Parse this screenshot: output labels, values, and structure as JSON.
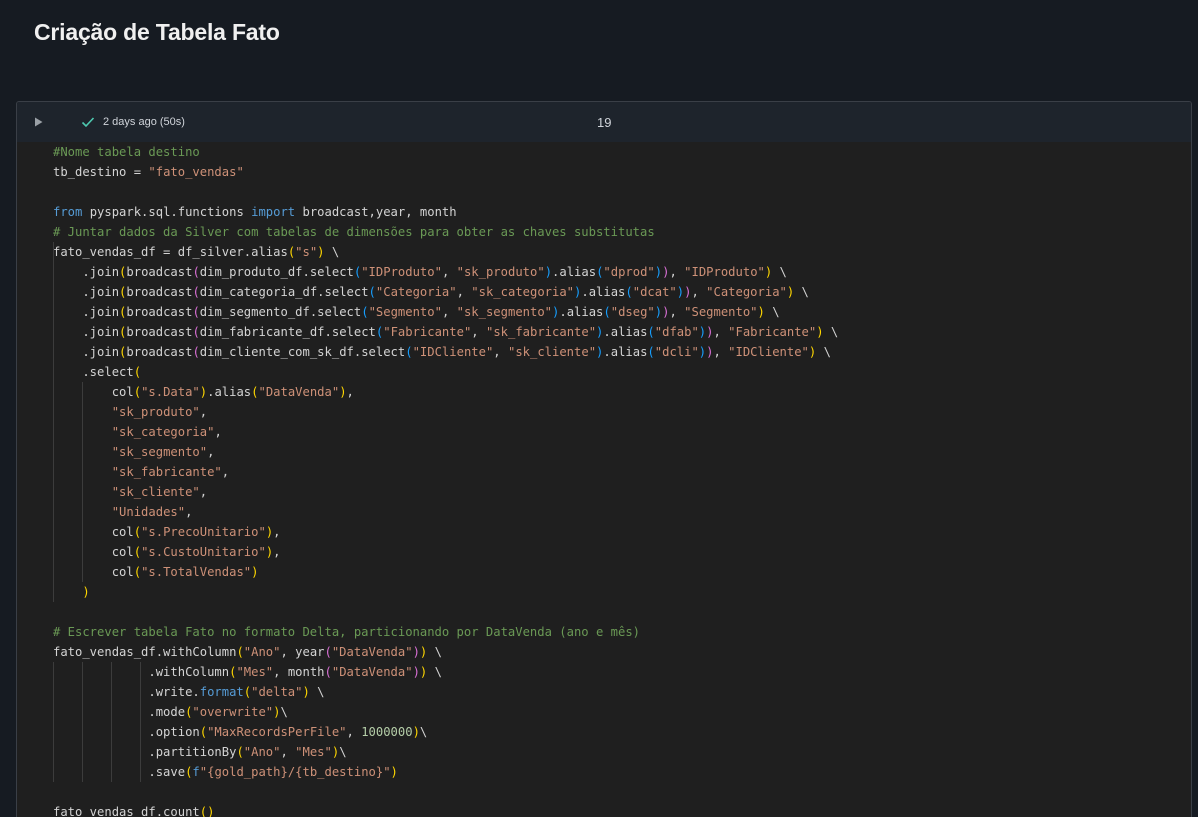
{
  "section": {
    "title": "Criação de Tabela Fato"
  },
  "cell": {
    "status": "2 days ago (50s)",
    "number": "19",
    "status_color": "#4ec9b0"
  },
  "code": {
    "lines": [
      "#Nome tabela destino",
      "tb_destino = \"fato_vendas\"",
      "",
      "from pyspark.sql.functions import broadcast,year, month",
      "# Juntar dados da Silver com tabelas de dimensões para obter as chaves substitutas",
      "fato_vendas_df = df_silver.alias(\"s\") \\",
      "    .join(broadcast(dim_produto_df.select(\"IDProduto\", \"sk_produto\").alias(\"dprod\")), \"IDProduto\") \\",
      "    .join(broadcast(dim_categoria_df.select(\"Categoria\", \"sk_categoria\").alias(\"dcat\")), \"Categoria\") \\",
      "    .join(broadcast(dim_segmento_df.select(\"Segmento\", \"sk_segmento\").alias(\"dseg\")), \"Segmento\") \\",
      "    .join(broadcast(dim_fabricante_df.select(\"Fabricante\", \"sk_fabricante\").alias(\"dfab\")), \"Fabricante\") \\",
      "    .join(broadcast(dim_cliente_com_sk_df.select(\"IDCliente\", \"sk_cliente\").alias(\"dcli\")), \"IDCliente\") \\",
      "    .select(",
      "        col(\"s.Data\").alias(\"DataVenda\"),",
      "        \"sk_produto\",",
      "        \"sk_categoria\",",
      "        \"sk_segmento\",",
      "        \"sk_fabricante\",",
      "        \"sk_cliente\",",
      "        \"Unidades\",",
      "        col(\"s.PrecoUnitario\"),",
      "        col(\"s.CustoUnitario\"),",
      "        col(\"s.TotalVendas\")",
      "    )",
      "",
      "# Escrever tabela Fato no formato Delta, particionando por DataVenda (ano e mês)",
      "fato_vendas_df.withColumn(\"Ano\", year(\"DataVenda\")) \\",
      "             .withColumn(\"Mes\", month(\"DataVenda\")) \\",
      "             .write.format(\"delta\") \\",
      "             .mode(\"overwrite\")\\",
      "             .option(\"MaxRecordsPerFile\", 1000000)\\",
      "             .partitionBy(\"Ano\", \"Mes\")\\",
      "             .save(f\"{gold_path}/{tb_destino}\")",
      "",
      "fato_vendas_df.count()"
    ]
  }
}
